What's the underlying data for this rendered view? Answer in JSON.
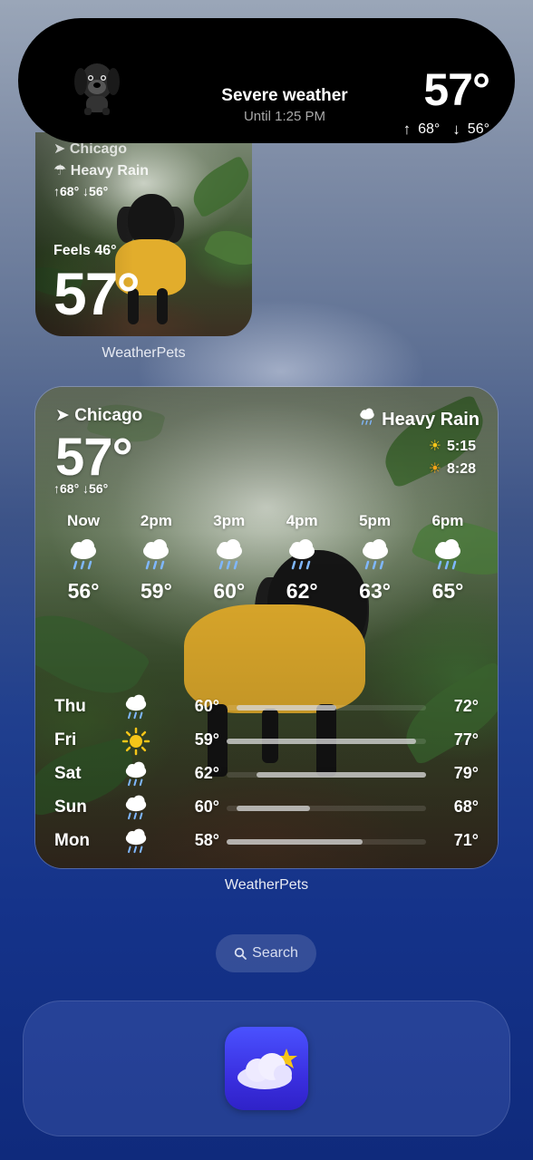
{
  "live_activity": {
    "title": "Severe weather",
    "subtitle": "Until 1:25 PM",
    "temperature": "57°",
    "high": "68°",
    "low": "56°"
  },
  "small_widget": {
    "city": "Chicago",
    "condition": "Heavy Rain",
    "range": "↑68° ↓56°",
    "feels_like": "Feels 46°",
    "temperature": "57°",
    "caption": "WeatherPets"
  },
  "large_widget": {
    "city": "Chicago",
    "temperature": "57°",
    "range": "↑68° ↓56°",
    "condition": "Heavy Rain",
    "sunrise": "5:15",
    "sunset": "8:28",
    "hourly": [
      {
        "label": "Now",
        "icon": "rain-cloud-icon",
        "temp": "56°"
      },
      {
        "label": "2pm",
        "icon": "rain-cloud-icon",
        "temp": "59°"
      },
      {
        "label": "3pm",
        "icon": "rain-cloud-icon",
        "temp": "60°"
      },
      {
        "label": "4pm",
        "icon": "rain-cloud-icon",
        "temp": "62°"
      },
      {
        "label": "5pm",
        "icon": "rain-cloud-icon",
        "temp": "63°"
      },
      {
        "label": "6pm",
        "icon": "rain-cloud-icon",
        "temp": "65°"
      }
    ],
    "daily": [
      {
        "day": "Thu",
        "icon": "rain-cloud-icon",
        "low": "60°",
        "high": "72°",
        "bar_start": 0.05,
        "bar_end": 0.55
      },
      {
        "day": "Fri",
        "icon": "sun-icon",
        "low": "59°",
        "high": "77°",
        "bar_start": 0.0,
        "bar_end": 0.95
      },
      {
        "day": "Sat",
        "icon": "rain-cloud-icon",
        "low": "62°",
        "high": "79°",
        "bar_start": 0.15,
        "bar_end": 1.0
      },
      {
        "day": "Sun",
        "icon": "rain-cloud-icon",
        "low": "60°",
        "high": "68°",
        "bar_start": 0.05,
        "bar_end": 0.42
      },
      {
        "day": "Mon",
        "icon": "rain-cloud-icon",
        "low": "58°",
        "high": "71°",
        "bar_start": 0.0,
        "bar_end": 0.68
      }
    ],
    "caption": "WeatherPets"
  },
  "search": {
    "label": "Search"
  },
  "dock": {
    "app_icon": "weatherpets-app-icon"
  },
  "colors": {
    "accent": "#3a2fe0",
    "coat": "#e2ad2c",
    "sun": "#f5c518"
  }
}
